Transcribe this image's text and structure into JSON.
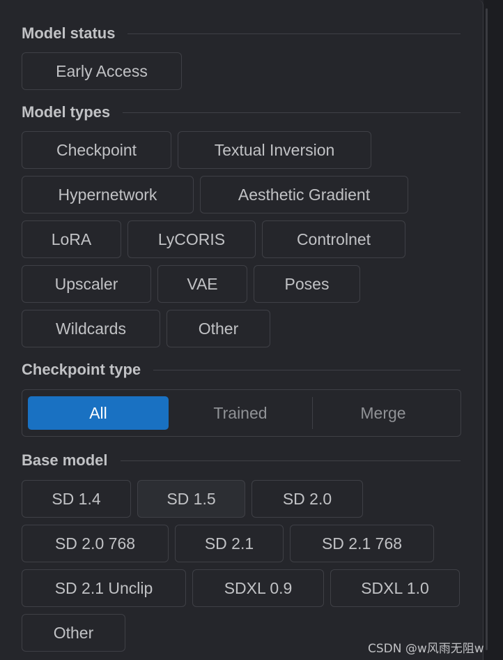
{
  "sections": {
    "model_status": {
      "title": "Model status",
      "options": [
        "Early Access"
      ]
    },
    "model_types": {
      "title": "Model types",
      "options": [
        "Checkpoint",
        "Textual Inversion",
        "Hypernetwork",
        "Aesthetic Gradient",
        "LoRA",
        "LyCORIS",
        "Controlnet",
        "Upscaler",
        "VAE",
        "Poses",
        "Wildcards",
        "Other"
      ]
    },
    "checkpoint_type": {
      "title": "Checkpoint type",
      "options": [
        "All",
        "Trained",
        "Merge"
      ],
      "selected": "All"
    },
    "base_model": {
      "title": "Base model",
      "options": [
        "SD 1.4",
        "SD 1.5",
        "SD 2.0",
        "SD 2.0 768",
        "SD 2.1",
        "SD 2.1 768",
        "SD 2.1 Unclip",
        "SDXL 0.9",
        "SDXL 1.0",
        "Other"
      ],
      "hovered": "SD 1.5"
    }
  },
  "watermark": "CSDN @w风雨无阻w",
  "colors": {
    "background": "#25262b",
    "accent": "#1971c2",
    "text": "#c1c2c5",
    "border": "#3f4046"
  }
}
